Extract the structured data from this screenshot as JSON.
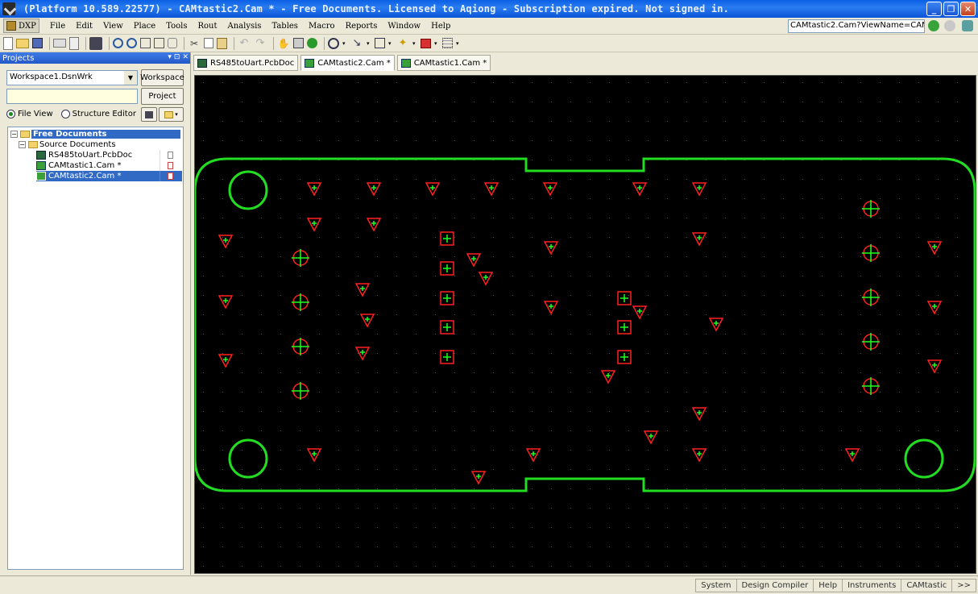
{
  "window": {
    "title": "(Platform 10.589.22577) - CAMtastic2.Cam * - Free Documents. Licensed to Aqiong - Subscription expired. Not signed in.",
    "buttons": [
      "_",
      "❐",
      "✕"
    ]
  },
  "menubar": {
    "dxp_label": "DXP",
    "items": [
      "File",
      "Edit",
      "View",
      "Place",
      "Tools",
      "Rout",
      "Analysis",
      "Tables",
      "Macro",
      "Reports",
      "Window",
      "Help"
    ],
    "nav_path": "CAMtastic2.Cam?ViewName=CAMtasti"
  },
  "projects": {
    "header": "Projects",
    "header_controls": [
      "▾",
      "⊡",
      "✕"
    ],
    "workspace_select": "Workspace1.DsnWrk",
    "workspace_button": "Workspace",
    "project_button": "Project",
    "view_options": [
      "File View",
      "Structure Editor"
    ],
    "tree": {
      "root": "Free Documents",
      "group": "Source Documents",
      "files": [
        "RS485toUart.PcbDoc",
        "CAMtastic1.Cam *",
        "CAMtastic2.Cam *"
      ],
      "selected": "CAMtastic2.Cam *"
    }
  },
  "tabs": [
    "RS485toUart.PcbDoc",
    "CAMtastic2.Cam *",
    "CAMtastic1.Cam *"
  ],
  "statusbar": {
    "items": [
      "System",
      "Design Compiler",
      "Help",
      "Instruments",
      "CAMtastic",
      ">>"
    ]
  },
  "colors": {
    "board_outline": "#22dd22",
    "pad": "#ff2020",
    "crosshair": "#20ff20"
  }
}
